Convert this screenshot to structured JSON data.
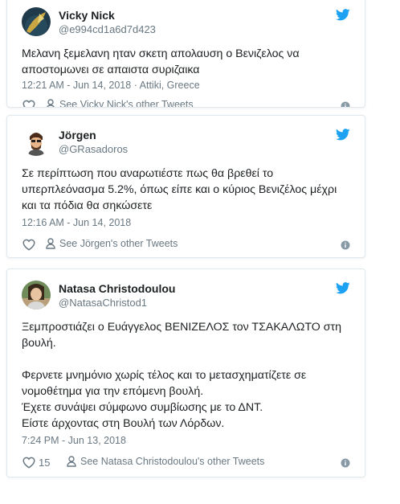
{
  "colors": {
    "twitter_blue": "#1da1f2",
    "text": "#1c2022",
    "muted": "#697882",
    "border": "#e1e8ed"
  },
  "tweets": [
    {
      "name": "Vicky Nick",
      "handle": "@e994cd1a6d7d423",
      "text_lines": [
        "Μελανη ξεμελανη ηταν σκετη απολαυση ο Βενιζελος να",
        "αποστομωνει σε απαιστα συριζαικα"
      ],
      "timestamp": "12:21 AM - Jun 14, 2018",
      "separator": " · ",
      "location": "Attiki, Greece",
      "likes": "",
      "profile_link": "See Vicky Nick's other Tweets",
      "icons": [
        "twitter-bird-icon",
        "heart-icon",
        "person-icon",
        "info-icon"
      ]
    },
    {
      "name": "Jörgen",
      "handle": "@GRasadoros",
      "text_lines": [
        "Σε περίπτωση που αναρωτιέστε πως θα βρεθεί το",
        "υπερπλεόνασμα 5.2%, όπως είπε και ο κύριος Βενιζέλος μέχρι",
        "και τα πόδια θα σηκώσετε"
      ],
      "timestamp": "12:16 AM - Jun 14, 2018",
      "likes": "",
      "profile_link": "See Jörgen's other Tweets",
      "icons": [
        "twitter-bird-icon",
        "heart-icon",
        "person-icon",
        "info-icon"
      ]
    },
    {
      "name": "Natasa Christodoulou",
      "handle": "@NatasaChristod1",
      "text_lines": [
        "Ξεμπροστιάζει ο Ευάγγελος ΒΕΝΙΖΕΛΟΣ τον ΤΣΑΚΑΛΩΤΟ στη",
        "βουλή."
      ],
      "text_lines_2": [
        "Φερνετε μνημόνιο χωρίς τέλος και το μετασχηματίζετε σε",
        "νομοθέτημα για την επόμενη βουλή.",
        "Έχετε συνάψει σύμφωνο συμβίωσης με το ΔΝΤ.",
        "Είστε άρχοντας στη Βουλή των Λόρδων."
      ],
      "timestamp": "7:24 PM - Jun 13, 2018",
      "likes": "15",
      "profile_link": "See Natasa Christodoulou's other Tweets",
      "icons": [
        "twitter-bird-icon",
        "heart-icon",
        "person-icon",
        "info-icon"
      ]
    }
  ]
}
